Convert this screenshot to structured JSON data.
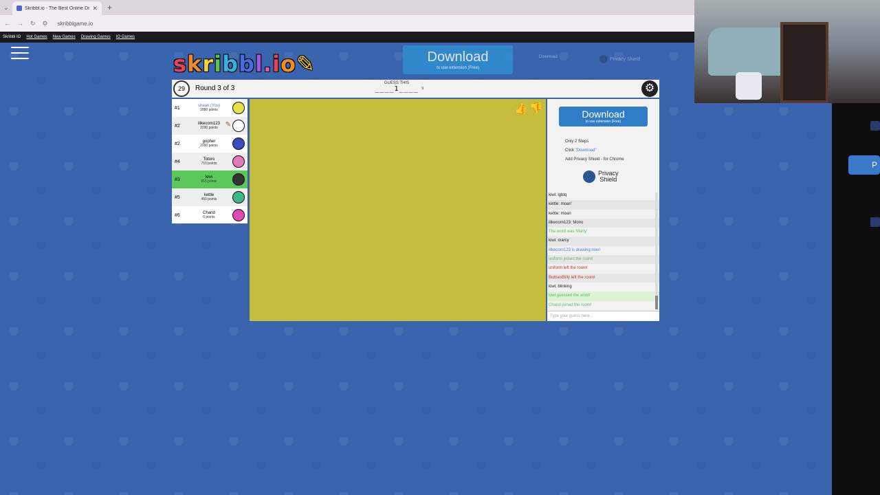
{
  "browser": {
    "tab_title": "Skribbl.io - The Best Online Dr...",
    "url": "skribblgame.io",
    "bookmarks": [
      "Skribbl IO",
      "Hot Games",
      "New Games",
      "Drawing Games",
      "IO Games"
    ]
  },
  "ads": {
    "download_main": "Download",
    "download_sub": "to use extension (Free)",
    "ad_small": "Download",
    "privacy_top": "Privacy Shield",
    "side_download_main": "Download",
    "side_download_sub": "to use extension (Free)",
    "steps_title": "Only 2 Steps",
    "step1_pre": "Click ",
    "step1_link": "\"Download\"",
    "step2": "Add Privacy Shield - for Chrome",
    "privacy_line1": "Privacy",
    "privacy_line2": "Shield"
  },
  "game": {
    "timer": "29",
    "round": "Round 3 of 3",
    "guess_label": "GUESS THIS",
    "word": "____1____",
    "letter_count": "9"
  },
  "players": [
    {
      "rank": "#1",
      "name": "shaan (You)",
      "points": "2880 points",
      "you": true,
      "color": "#e6e04a"
    },
    {
      "rank": "#2",
      "name": "ilikecorn123",
      "points": "2290 points",
      "you": false,
      "color": "#ffffff",
      "drawing": true
    },
    {
      "rank": "#2",
      "name": "gopher",
      "points": "2290 points",
      "you": false,
      "color": "#3a4ac0"
    },
    {
      "rank": "#4",
      "name": "Totoro",
      "points": "710 points",
      "you": false,
      "color": "#e07ab8"
    },
    {
      "rank": "#3",
      "name": "kiwi",
      "points": "815 points",
      "you": false,
      "color": "#333333",
      "active": true
    },
    {
      "rank": "#5",
      "name": "kettle",
      "points": "450 points",
      "you": false,
      "color": "#3ab88a"
    },
    {
      "rank": "#6",
      "name": "Chand",
      "points": "0 points",
      "you": false,
      "color": "#e04ab8"
    }
  ],
  "chat": [
    {
      "text": "kiwi: lgbtq",
      "type": "normal"
    },
    {
      "text": "kettle: moan'",
      "type": "normal"
    },
    {
      "text": "kettle: moan",
      "type": "normal"
    },
    {
      "text": "ilikecorn123: Mono",
      "type": "normal"
    },
    {
      "text": "The word was 'Marty'",
      "type": "green"
    },
    {
      "text": "kiwi: marcy",
      "type": "normal"
    },
    {
      "text": "ilikecorn123 is drawing now!",
      "type": "blue"
    },
    {
      "text": "uniform joined the room!",
      "type": "green"
    },
    {
      "text": "uniform left the room!",
      "type": "red"
    },
    {
      "text": "ButtsexBilly left the room!",
      "type": "red"
    },
    {
      "text": "kiwi: blinking",
      "type": "normal"
    },
    {
      "text": "kiwi guessed the word!",
      "type": "green",
      "hl": true
    },
    {
      "text": "Chand joined the room!",
      "type": "green"
    }
  ],
  "chat_placeholder": "Type your guess here...",
  "logo_text": "skribbl.io"
}
